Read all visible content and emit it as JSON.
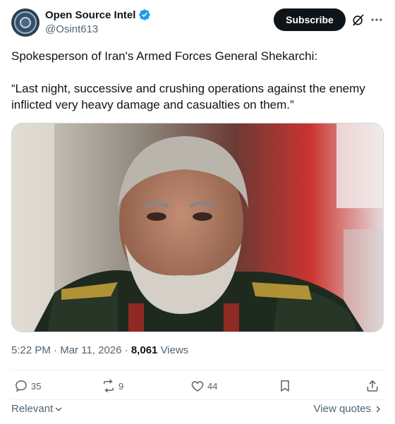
{
  "author": {
    "display_name": "Open Source Intel",
    "handle": "@Osint613",
    "avatar_icon": "account-avatar",
    "verified_icon": "verified-badge-icon"
  },
  "header": {
    "subscribe_label": "Subscribe",
    "grok_icon": "grok-icon",
    "more_icon": "more-horizontal-icon"
  },
  "tweet": {
    "line1": "Spokesperson of Iran's Armed Forces General Shekarchi:",
    "line2": "“Last night, successive and crushing operations against the enemy inflicted very heavy damage and casualties on them.”",
    "media_alt": "Portrait of a bearded military general in uniform in front of a flag"
  },
  "meta": {
    "time": "5:22 PM",
    "sep1": "·",
    "date": "Mar 11, 2026",
    "sep2": "·",
    "views_count": "8,061",
    "views_label": "Views"
  },
  "actions": {
    "replies": "35",
    "reposts": "9",
    "likes": "44"
  },
  "footer": {
    "relevant_label": "Relevant",
    "view_quotes_label": "View quotes"
  },
  "colors": {
    "accent_blue": "#1d9bf0",
    "text_primary": "#0f1419",
    "text_secondary": "#536471",
    "button_dark": "#0f1419"
  }
}
